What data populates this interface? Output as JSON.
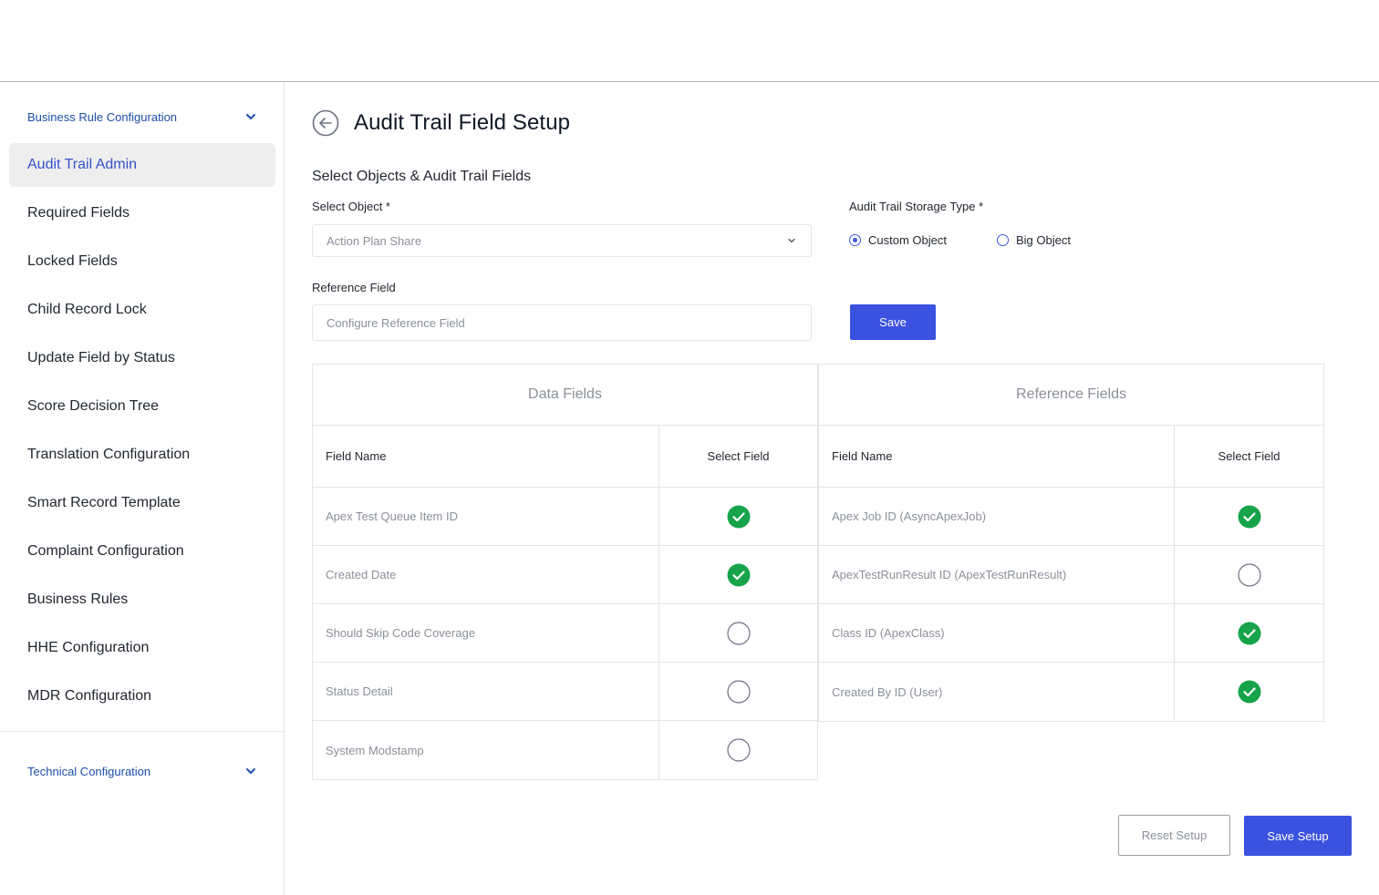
{
  "sidebar": {
    "business_section": "Business Rule Configuration",
    "technical_section": "Technical Configuration",
    "items": [
      {
        "label": "Audit Trail Admin",
        "active": true
      },
      {
        "label": "Required Fields"
      },
      {
        "label": "Locked Fields"
      },
      {
        "label": "Child Record Lock"
      },
      {
        "label": "Update Field by Status"
      },
      {
        "label": "Score Decision Tree"
      },
      {
        "label": "Translation Configuration"
      },
      {
        "label": "Smart Record Template"
      },
      {
        "label": "Complaint Configuration"
      },
      {
        "label": "Business Rules"
      },
      {
        "label": "HHE Configuration"
      },
      {
        "label": "MDR Configuration"
      }
    ]
  },
  "page": {
    "title": "Audit Trail Field Setup",
    "subtitle": "Select Objects & Audit Trail Fields"
  },
  "form": {
    "object_label": "Select Object *",
    "object_value": "Action Plan Share",
    "storage_label": "Audit Trail Storage Type *",
    "storage_options": [
      "Custom Object",
      "Big Object"
    ],
    "storage_selected": "Custom Object",
    "reference_label": "Reference Field",
    "reference_placeholder": "Configure Reference Field",
    "save_label": "Save"
  },
  "data_fields": {
    "title": "Data Fields",
    "col_name": "Field Name",
    "col_select": "Select Field",
    "rows": [
      {
        "name": "Apex Test Queue Item ID",
        "selected": true
      },
      {
        "name": "Created Date",
        "selected": true
      },
      {
        "name": "Should Skip Code Coverage",
        "selected": false
      },
      {
        "name": "Status Detail",
        "selected": false
      },
      {
        "name": "System Modstamp",
        "selected": false
      }
    ]
  },
  "reference_fields": {
    "title": "Reference Fields",
    "col_name": "Field Name",
    "col_select": "Select Field",
    "rows": [
      {
        "name": "Apex Job ID (AsyncApexJob)",
        "selected": true
      },
      {
        "name": "ApexTestRunResult ID (ApexTestRunResult)",
        "selected": false
      },
      {
        "name": "Class ID (ApexClass)",
        "selected": true
      },
      {
        "name": "Created By ID (User)",
        "selected": true
      }
    ]
  },
  "footer": {
    "reset_label": "Reset Setup",
    "save_setup_label": "Save Setup"
  },
  "colors": {
    "accent": "#3b51e0",
    "check_on": "#16a34a",
    "link": "#1d4ea8"
  }
}
